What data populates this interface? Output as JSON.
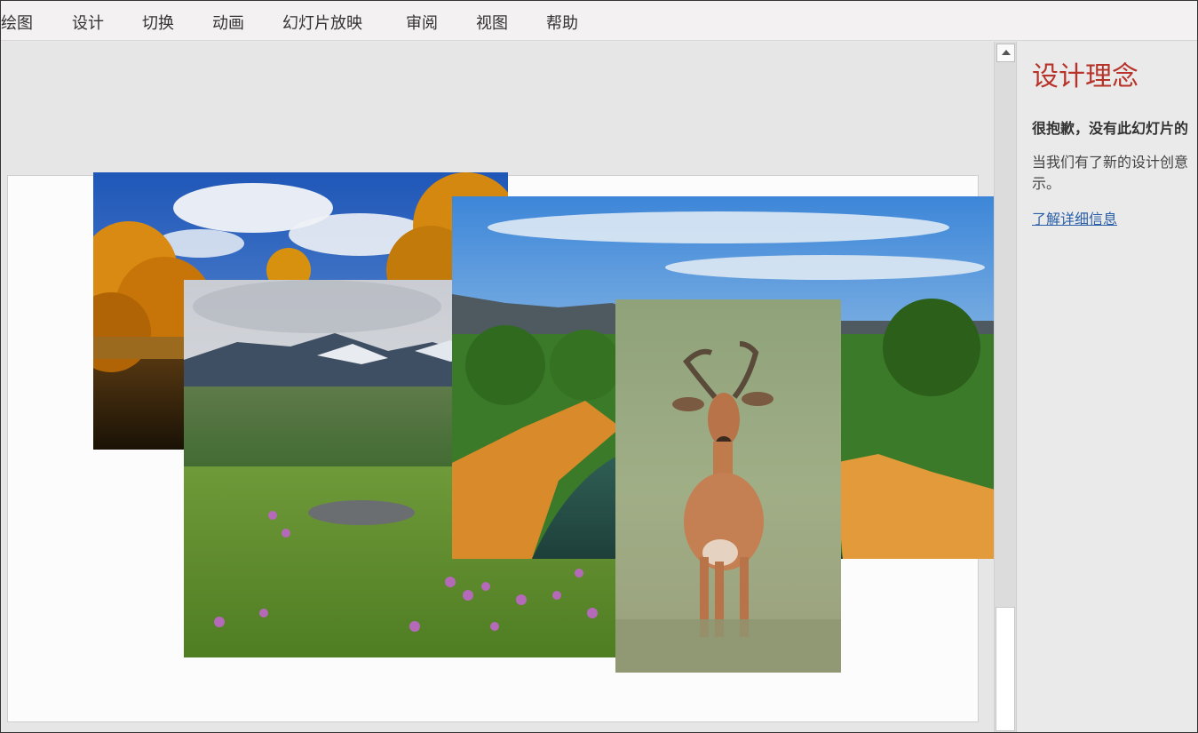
{
  "ribbon": {
    "tabs": [
      "绘图",
      "设计",
      "切换",
      "动画",
      "幻灯片放映",
      "审阅",
      "视图",
      "帮助"
    ]
  },
  "designer": {
    "title": "设计理念",
    "sorry_text": "很抱歉，没有此幻灯片的",
    "description": "当我们有了新的设计创意时，我们会向您显示。",
    "desc_line1": "当我们有了新的设计创意",
    "desc_line2": "示。",
    "learn_more": "了解详细信息"
  },
  "slide": {
    "pictures": [
      "autumn-lake-photo",
      "mountain-meadow-photo",
      "river-canyon-photo",
      "antelope-photo"
    ]
  },
  "colors": {
    "accent_title": "#b7332a",
    "link": "#2a5fa8"
  }
}
